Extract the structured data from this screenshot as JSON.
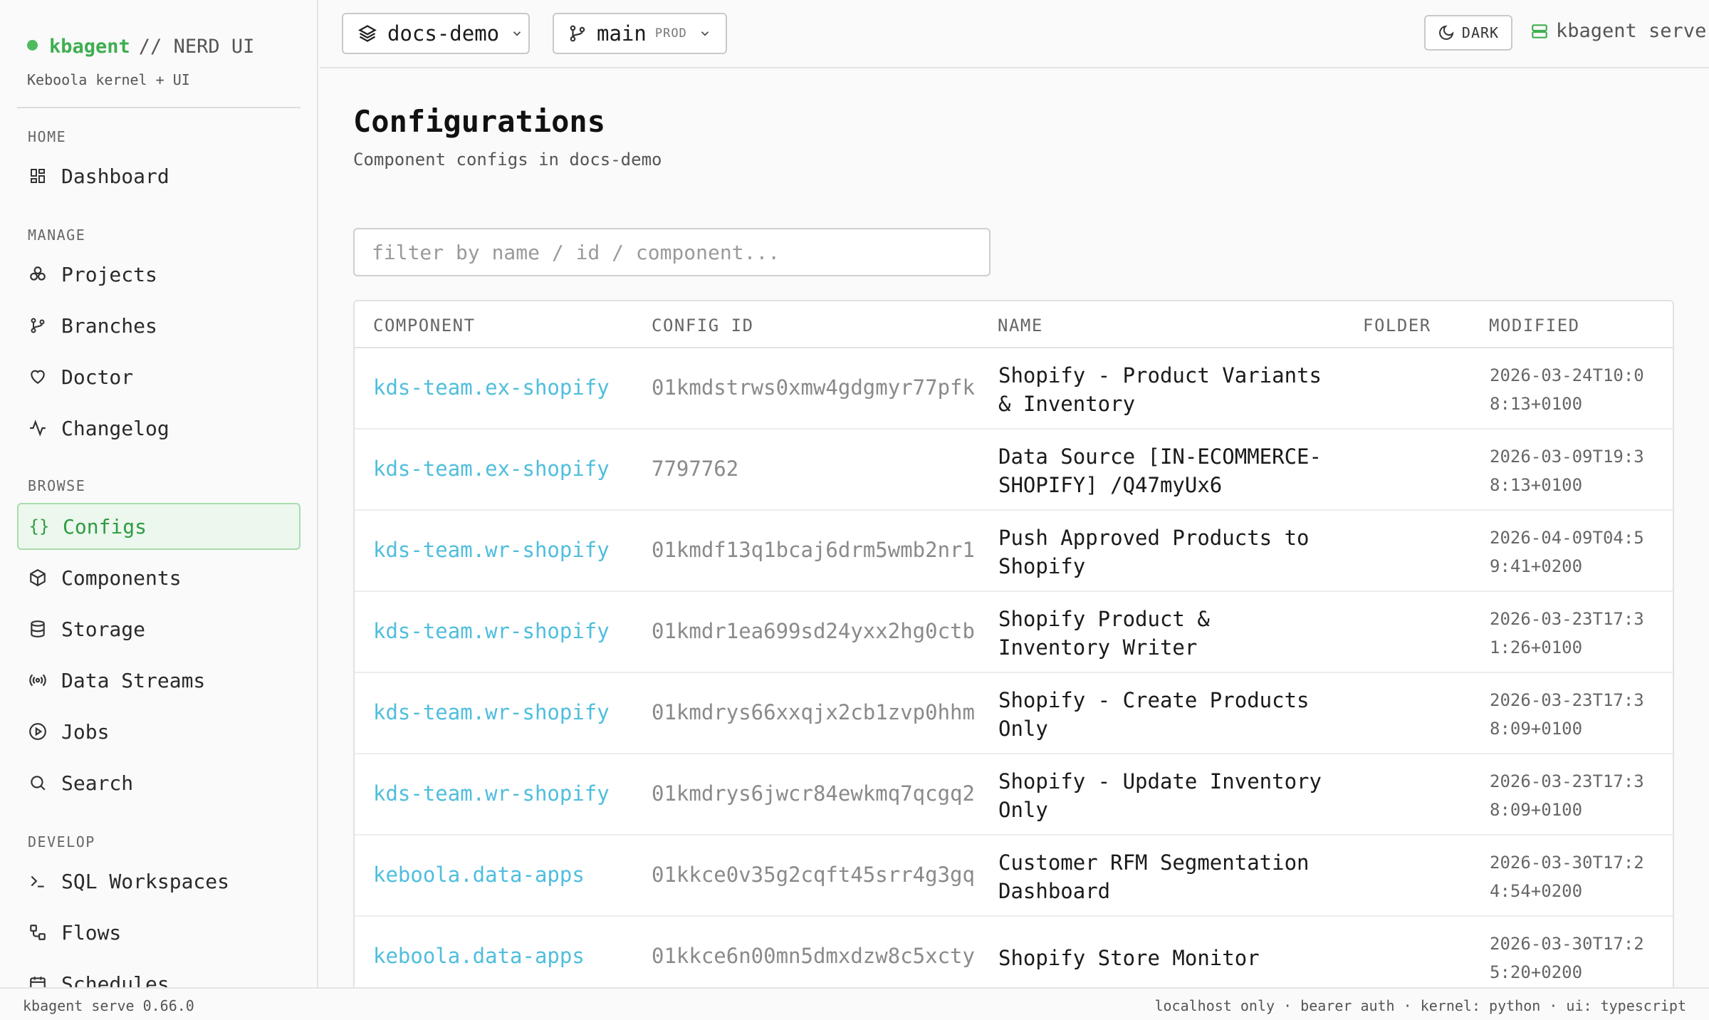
{
  "brand": {
    "name": "kbagent",
    "tag": "// NERD UI",
    "subtitle": "Keboola kernel + UI"
  },
  "sidebar": {
    "sections": [
      {
        "label": "HOME",
        "items": [
          {
            "label": "Dashboard",
            "icon": "dashboard-icon"
          }
        ]
      },
      {
        "label": "MANAGE",
        "items": [
          {
            "label": "Projects",
            "icon": "projects-icon"
          },
          {
            "label": "Branches",
            "icon": "git-branch-icon"
          },
          {
            "label": "Doctor",
            "icon": "heart-icon"
          },
          {
            "label": "Changelog",
            "icon": "activity-icon"
          }
        ]
      },
      {
        "label": "BROWSE",
        "items": [
          {
            "label": "Configs",
            "icon": "braces-icon",
            "active": true
          },
          {
            "label": "Components",
            "icon": "package-icon"
          },
          {
            "label": "Storage",
            "icon": "database-icon"
          },
          {
            "label": "Data Streams",
            "icon": "radio-icon"
          },
          {
            "label": "Jobs",
            "icon": "play-circle-icon"
          },
          {
            "label": "Search",
            "icon": "search-icon"
          }
        ]
      },
      {
        "label": "DEVELOP",
        "items": [
          {
            "label": "SQL Workspaces",
            "icon": "terminal-icon"
          },
          {
            "label": "Flows",
            "icon": "flow-icon"
          },
          {
            "label": "Schedules",
            "icon": "calendar-icon"
          }
        ]
      }
    ]
  },
  "topbar": {
    "project": "docs-demo",
    "branch": "main",
    "branch_tag": "PROD",
    "theme_label": "DARK",
    "serve_label": "kbagent serve"
  },
  "main": {
    "title": "Configurations",
    "subtitle": "Component configs in docs-demo",
    "filter_placeholder": "filter by name / id / component...",
    "columns": [
      "COMPONENT",
      "CONFIG ID",
      "NAME",
      "FOLDER",
      "MODIFIED"
    ],
    "rows": [
      {
        "component": "kds-team.ex-shopify",
        "config_id": "01kmdstrws0xmw4gdgmyr77pfk",
        "name": "Shopify - Product Variants & Inventory",
        "folder": "",
        "modified": "2026-03-24T10:08:13+0100"
      },
      {
        "component": "kds-team.ex-shopify",
        "config_id": "7797762",
        "name": "Data Source [IN-ECOMMERCE-SHOPIFY] /Q47myUx6",
        "folder": "",
        "modified": "2026-03-09T19:38:13+0100"
      },
      {
        "component": "kds-team.wr-shopify",
        "config_id": "01kmdf13q1bcaj6drm5wmb2nr1",
        "name": "Push Approved Products to Shopify",
        "folder": "",
        "modified": "2026-04-09T04:59:41+0200"
      },
      {
        "component": "kds-team.wr-shopify",
        "config_id": "01kmdr1ea699sd24yxx2hg0ctb",
        "name": "Shopify Product & Inventory Writer",
        "folder": "",
        "modified": "2026-03-23T17:31:26+0100"
      },
      {
        "component": "kds-team.wr-shopify",
        "config_id": "01kmdrys66xxqjx2cb1zvp0hhm",
        "name": "Shopify - Create Products Only",
        "folder": "",
        "modified": "2026-03-23T17:38:09+0100"
      },
      {
        "component": "kds-team.wr-shopify",
        "config_id": "01kmdrys6jwcr84ewkmq7qcgq2",
        "name": "Shopify - Update Inventory Only",
        "folder": "",
        "modified": "2026-03-23T17:38:09+0100"
      },
      {
        "component": "keboola.data-apps",
        "config_id": "01kkce0v35g2cqft45srr4g3gq",
        "name": "Customer RFM Segmentation Dashboard",
        "folder": "",
        "modified": "2026-03-30T17:24:54+0200"
      },
      {
        "component": "keboola.data-apps",
        "config_id": "01kkce6n00mn5dmxdzw8c5xcty",
        "name": "Shopify Store Monitor",
        "folder": "",
        "modified": "2026-03-30T17:25:20+0200"
      }
    ]
  },
  "footer": {
    "version": "kbagent serve 0.66.0",
    "status": "localhost only · bearer auth · kernel: python · ui: typescript"
  },
  "colors": {
    "accent": "#3fae52",
    "link": "#4fbedd",
    "active_bg": "#ecf7ed"
  }
}
